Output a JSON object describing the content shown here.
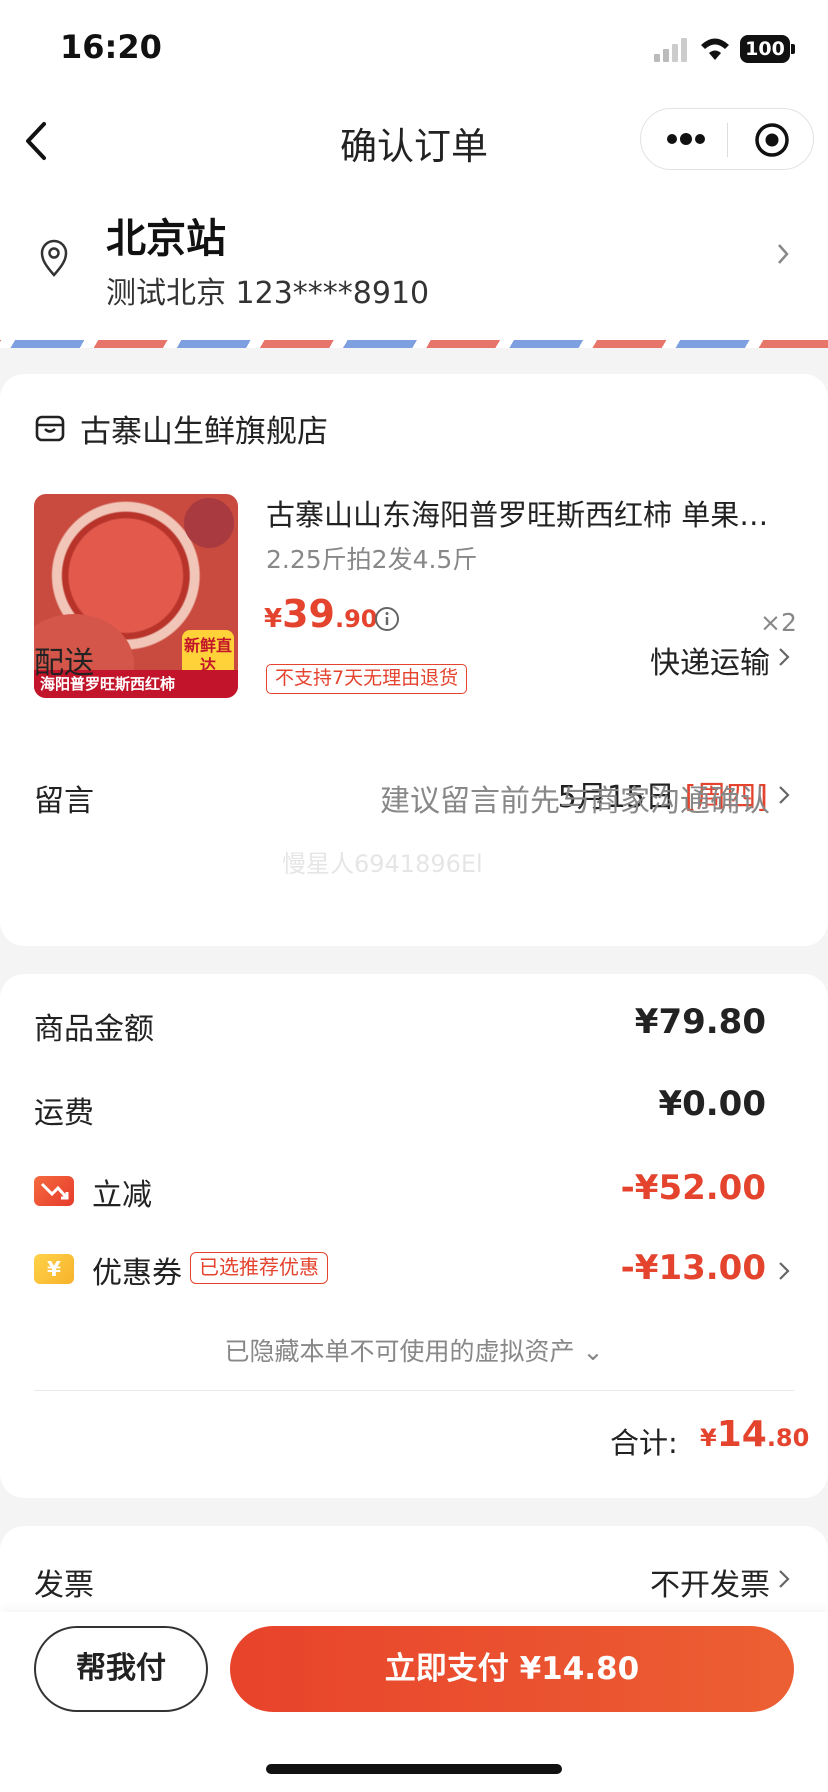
{
  "status_bar": {
    "time": "16:20",
    "battery": "100"
  },
  "nav": {
    "title": "确认订单"
  },
  "address": {
    "name": "北京站",
    "detail": "测试北京 123****8910"
  },
  "shop": {
    "name": "古寨山生鲜旗舰店",
    "product": {
      "title": "古寨山山东海阳普罗旺斯西红柿 单果…",
      "spec": "2.25斤拍2发4.5斤",
      "price_currency": "¥",
      "price_int": "39",
      "price_dec": ".90",
      "quantity": "×2",
      "return_tag": "不支持7天无理由退货",
      "image_banner": "海阳普罗旺斯西红柿",
      "image_badge": "新鲜直达"
    },
    "delivery_label": "配送",
    "delivery_method": "快递运输",
    "delivery_date": "5月15日",
    "delivery_weekday": "[周四]",
    "message_label": "留言",
    "message_hint": "建议留言前先与商家沟通确认"
  },
  "watermark": "慢星人6941896El",
  "summary": {
    "goods_label": "商品金额",
    "goods_value": "¥79.80",
    "freight_label": "运费",
    "freight_value": "¥0.00",
    "discount_label": "立减",
    "discount_value": "-¥52.00",
    "coupon_label": "优惠券",
    "coupon_tag": "已选推荐优惠",
    "coupon_value": "-¥13.00",
    "coupon_icon_glyph": "¥",
    "hidden_assets": "已隐藏本单不可使用的虚拟资产 ⌄",
    "total_label": "合计:",
    "total_currency": "¥",
    "total_int": "14",
    "total_dec": ".80"
  },
  "invoice": {
    "label": "发票",
    "value": "不开发票"
  },
  "bottom": {
    "help_pay": "帮我付",
    "pay_now": "立即支付 ¥14.80"
  },
  "colors": {
    "accent": "#e4432e",
    "text": "#222222",
    "muted": "#888888",
    "background": "#f4f4f4"
  }
}
